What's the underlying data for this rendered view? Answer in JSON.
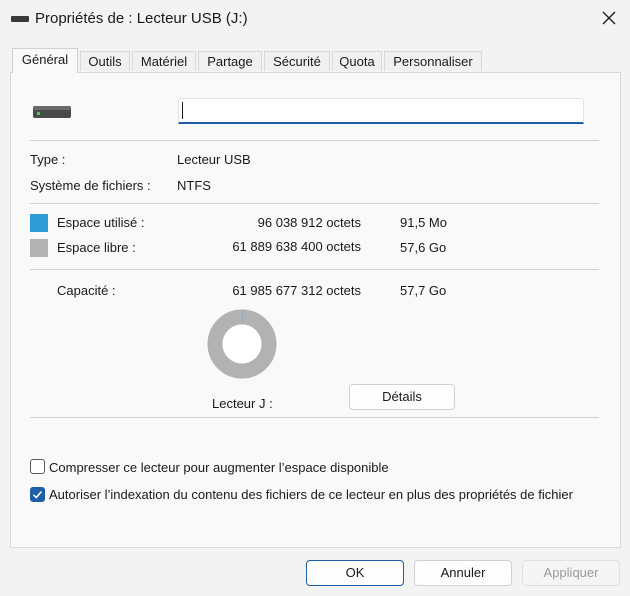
{
  "window": {
    "title": "Propriétés de : Lecteur USB (J:)"
  },
  "tabs": [
    {
      "label": "Général"
    },
    {
      "label": "Outils"
    },
    {
      "label": "Matériel"
    },
    {
      "label": "Partage"
    },
    {
      "label": "Sécurité"
    },
    {
      "label": "Quota"
    },
    {
      "label": "Personnaliser"
    }
  ],
  "drive": {
    "name_value": "",
    "icon": "usb-drive-icon"
  },
  "info": {
    "type_label": "Type :",
    "type_value": "Lecteur USB",
    "fs_label": "Système de fichiers :",
    "fs_value": "NTFS"
  },
  "space": {
    "used_label": "Espace utilisé :",
    "used_bytes": "96 038 912 octets",
    "used_short": "91,5 Mo",
    "used_color": "#2e9bd6",
    "free_label": "Espace libre :",
    "free_bytes": "61 889 638 400 octets",
    "free_short": "57,6 Go",
    "free_color": "#b2b2b2",
    "capacity_label": "Capacité :",
    "capacity_bytes": "61 985 677 312 octets",
    "capacity_short": "57,7 Go",
    "used_fraction": 0.0015
  },
  "drive_label": "Lecteur J :",
  "details_button": "Détails",
  "options": {
    "compress_label": "Compresser ce lecteur pour augmenter l’espace disponible",
    "compress_checked": false,
    "index_label": "Autoriser l’indexation du contenu des fichiers de ce lecteur en plus des propriétés de fichier",
    "index_checked": true
  },
  "buttons": {
    "ok": "OK",
    "cancel": "Annuler",
    "apply": "Appliquer"
  }
}
